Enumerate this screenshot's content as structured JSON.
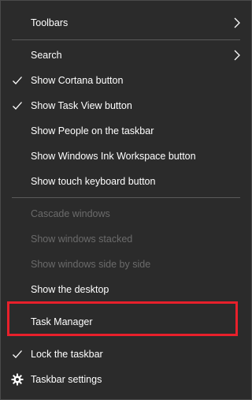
{
  "menu": {
    "toolbars": "Toolbars",
    "search": "Search",
    "show_cortana": "Show Cortana button",
    "show_task_view": "Show Task View button",
    "show_people": "Show People on the taskbar",
    "show_ink": "Show Windows Ink Workspace button",
    "show_touch_keyboard": "Show touch keyboard button",
    "cascade": "Cascade windows",
    "stacked": "Show windows stacked",
    "side_by_side": "Show windows side by side",
    "show_desktop": "Show the desktop",
    "task_manager": "Task Manager",
    "lock_taskbar": "Lock the taskbar",
    "taskbar_settings": "Taskbar settings"
  },
  "colors": {
    "background": "#2b2b2b",
    "text": "#ffffff",
    "disabled_text": "#6b6b6b",
    "highlight_border": "#e8202b"
  }
}
